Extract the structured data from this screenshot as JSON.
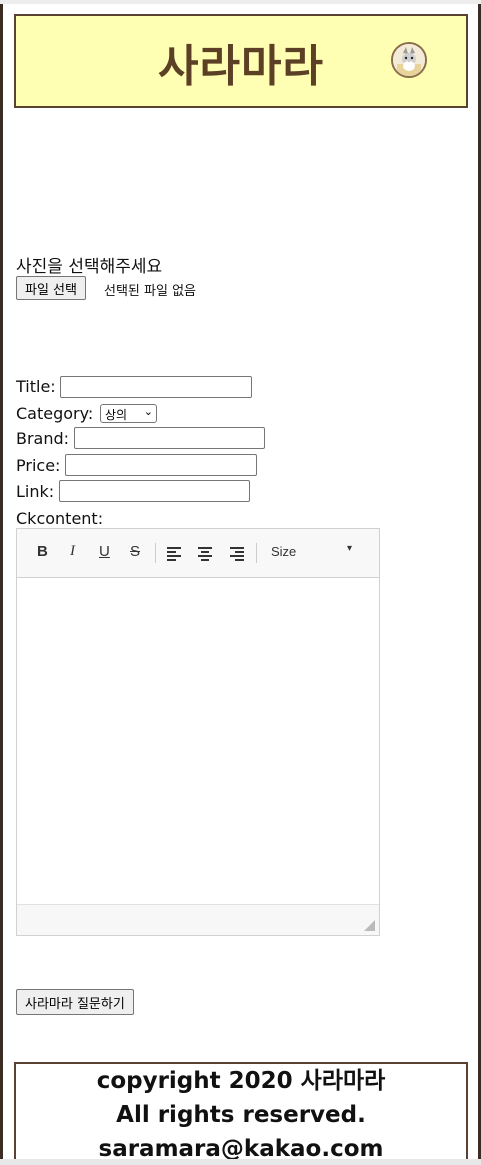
{
  "header": {
    "logo": "사라마라",
    "avatar_icon": "cat-avatar-icon"
  },
  "upload": {
    "label": "사진을 선택해주세요",
    "button_label": "파일 선택",
    "status": "선택된 파일 없음"
  },
  "form": {
    "title_label": "Title:",
    "title_value": "",
    "category_label": "Category:",
    "category_selected": "상의",
    "brand_label": "Brand:",
    "brand_value": "",
    "price_label": "Price:",
    "price_value": "",
    "link_label": "Link:",
    "link_value": "",
    "ckcontent_label": "Ckcontent:"
  },
  "editor": {
    "bold": "B",
    "italic": "I",
    "underline": "U",
    "strike": "S",
    "size_label": "Size",
    "content": ""
  },
  "submit": {
    "label": "사라마라 질문하기"
  },
  "footer": {
    "line1": "copyright 2020 사라마라",
    "line2": "All rights reserved.",
    "line3": "saramara@kakao.com"
  },
  "colors": {
    "header_bg": "#ffffb3",
    "logo": "#5c4026",
    "border": "#5a4232"
  }
}
